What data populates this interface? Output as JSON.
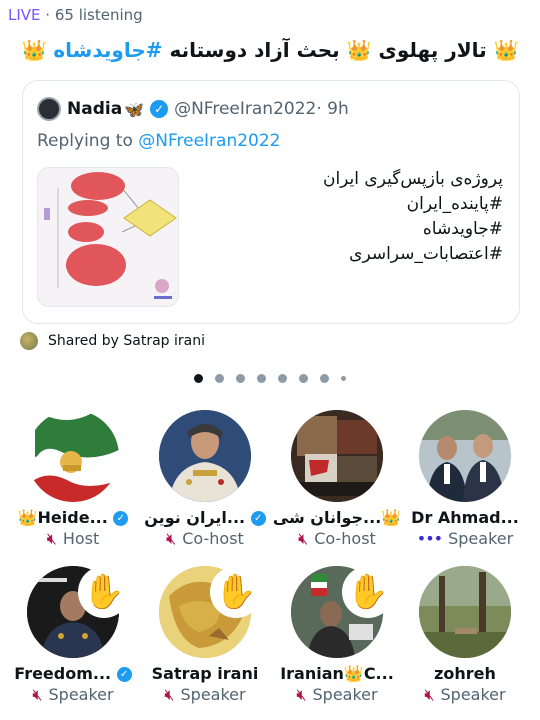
{
  "status": {
    "live": "LIVE",
    "separator": " · ",
    "listening": "65 listening"
  },
  "space": {
    "title_start": "👑 تالار پهلوی 👑 بحث آزاد دوستانه ",
    "title_hashtag": "#جاویدشاه"
  },
  "card": {
    "author_name": "Nadia",
    "author_emoji": "🦋",
    "handle": "@NFreeIran2022",
    "time": "· 9h",
    "replying_label": "Replying to ",
    "replying_mention": "@NFreeIran2022",
    "lines": [
      "پروژه‌ی بازپس‌گیری ایران",
      "#پاینده_ایران",
      "#جاویدشاه",
      "#اعتصابات_سراسری"
    ]
  },
  "shared": {
    "label": "Shared by Satrap irani"
  },
  "carousel": {
    "active_index": 0,
    "count": 8
  },
  "participants": [
    {
      "name": "👑Heide...",
      "verified": true,
      "role": "Host",
      "muted": true,
      "hand": false
    },
    {
      "name": "ایران نوین...",
      "verified": true,
      "role": "Co-host",
      "muted": true,
      "hand": false
    },
    {
      "name": "جوانان شی...👑",
      "verified": false,
      "role": "Co-host",
      "muted": true,
      "hand": false
    },
    {
      "name": "Dr Ahmad...",
      "verified": false,
      "role": "Speaker",
      "muted": false,
      "hand": false
    },
    {
      "name": "Freedom...",
      "verified": true,
      "role": "Speaker",
      "muted": true,
      "hand": true
    },
    {
      "name": "Satrap irani",
      "verified": false,
      "role": "Speaker",
      "muted": true,
      "hand": true
    },
    {
      "name": "Iranian👑C...",
      "verified": false,
      "role": "Speaker",
      "muted": true,
      "hand": true
    },
    {
      "name": "zohreh",
      "verified": false,
      "role": "Speaker",
      "muted": true,
      "hand": false
    }
  ],
  "icons": {
    "mic_off": "mic-off-icon",
    "speaking": "speaking-icon",
    "raised_hand": "✋",
    "verified": "✓"
  },
  "colors": {
    "accent": "#1d9bf0",
    "live": "#7856ff",
    "mic_off": "#b0124c",
    "secondary_text": "#536471"
  }
}
